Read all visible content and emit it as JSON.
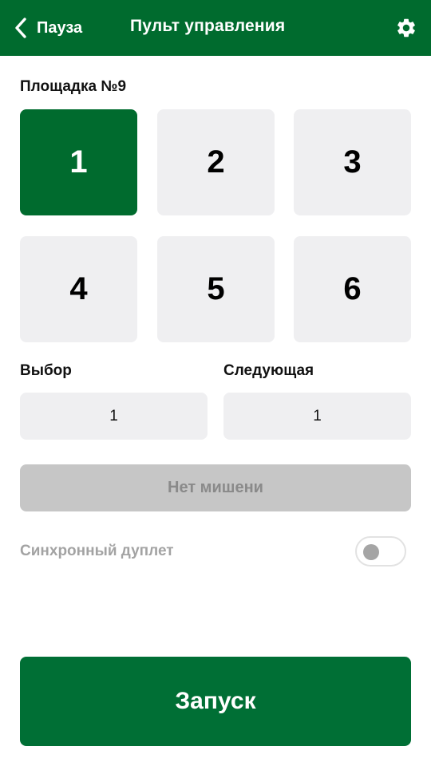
{
  "header": {
    "back_label": "Пауза",
    "title": "Пульт управления",
    "back_icon": "chevron-left-icon",
    "settings_icon": "gear-icon"
  },
  "site": {
    "label": "Площадка №9",
    "buttons": [
      "1",
      "2",
      "3",
      "4",
      "5",
      "6"
    ],
    "selected": "1"
  },
  "choice": {
    "label": "Выбор",
    "value": "1"
  },
  "next": {
    "label": "Следующая",
    "value": "1"
  },
  "target_status": "Нет мишени",
  "sync_doublet": {
    "label": "Синхронный дуплет",
    "enabled": false
  },
  "launch_label": "Запуск",
  "colors": {
    "brand_green": "#006b2e",
    "tile_bg": "#efeff1",
    "disabled_bg": "#c6c6c6",
    "disabled_text": "#8a8a8a"
  }
}
